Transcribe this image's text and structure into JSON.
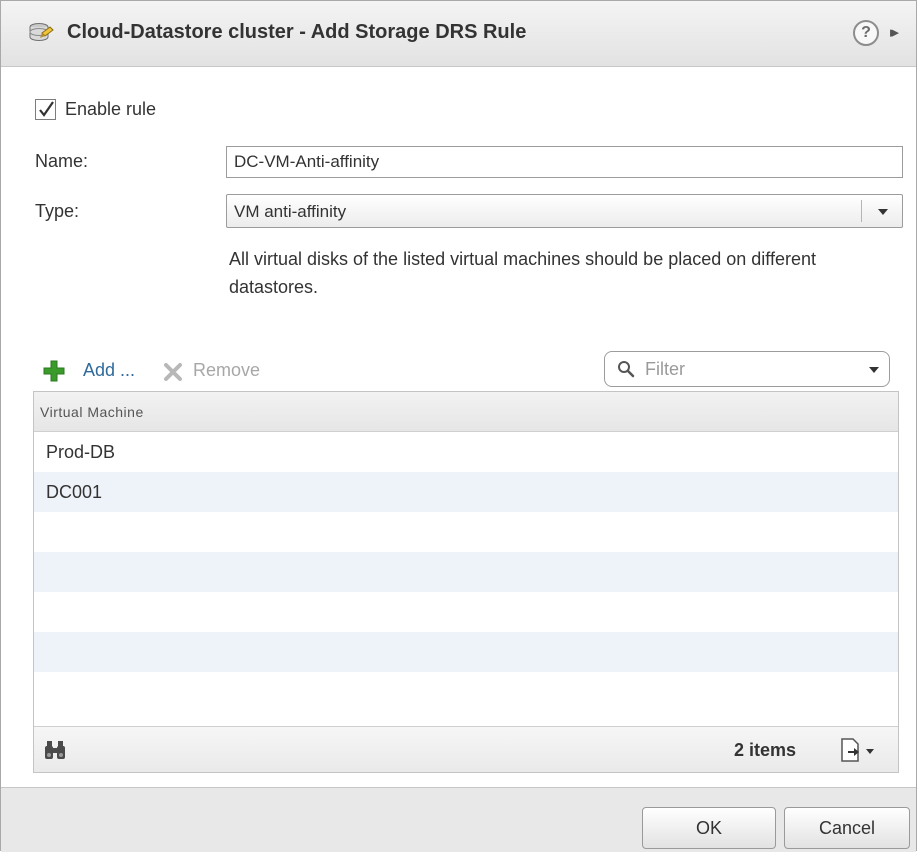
{
  "window": {
    "title": "Cloud-Datastore cluster - Add Storage DRS Rule",
    "help_symbol": "?",
    "expand_symbol": "▸▸"
  },
  "form": {
    "enable_rule": {
      "label": "Enable rule",
      "checked": true
    },
    "name": {
      "label": "Name:",
      "value": "DC-VM-Anti-affinity"
    },
    "type": {
      "label": "Type:",
      "selected": "VM anti-affinity"
    },
    "description": "All virtual disks of the listed virtual machines should be placed on different datastores."
  },
  "toolbar": {
    "add_label": "Add ...",
    "remove_label": "Remove",
    "filter_placeholder": "Filter"
  },
  "grid": {
    "column_header": "Virtual Machine",
    "rows": [
      "Prod-DB",
      "DC001"
    ],
    "item_count": "2 items"
  },
  "buttons": {
    "ok": "OK",
    "cancel": "Cancel"
  },
  "colors": {
    "add_green": "#3a9a2a",
    "remove_gray": "#a7a7a7",
    "row_alt": "#eef3f9"
  },
  "icons": {
    "title": "datastore-cluster-icon",
    "help": "help-icon",
    "expand": "expand-icon",
    "add": "plus-icon",
    "remove": "x-icon",
    "filter": "search-icon",
    "find": "binoculars-icon",
    "export": "export-icon"
  }
}
